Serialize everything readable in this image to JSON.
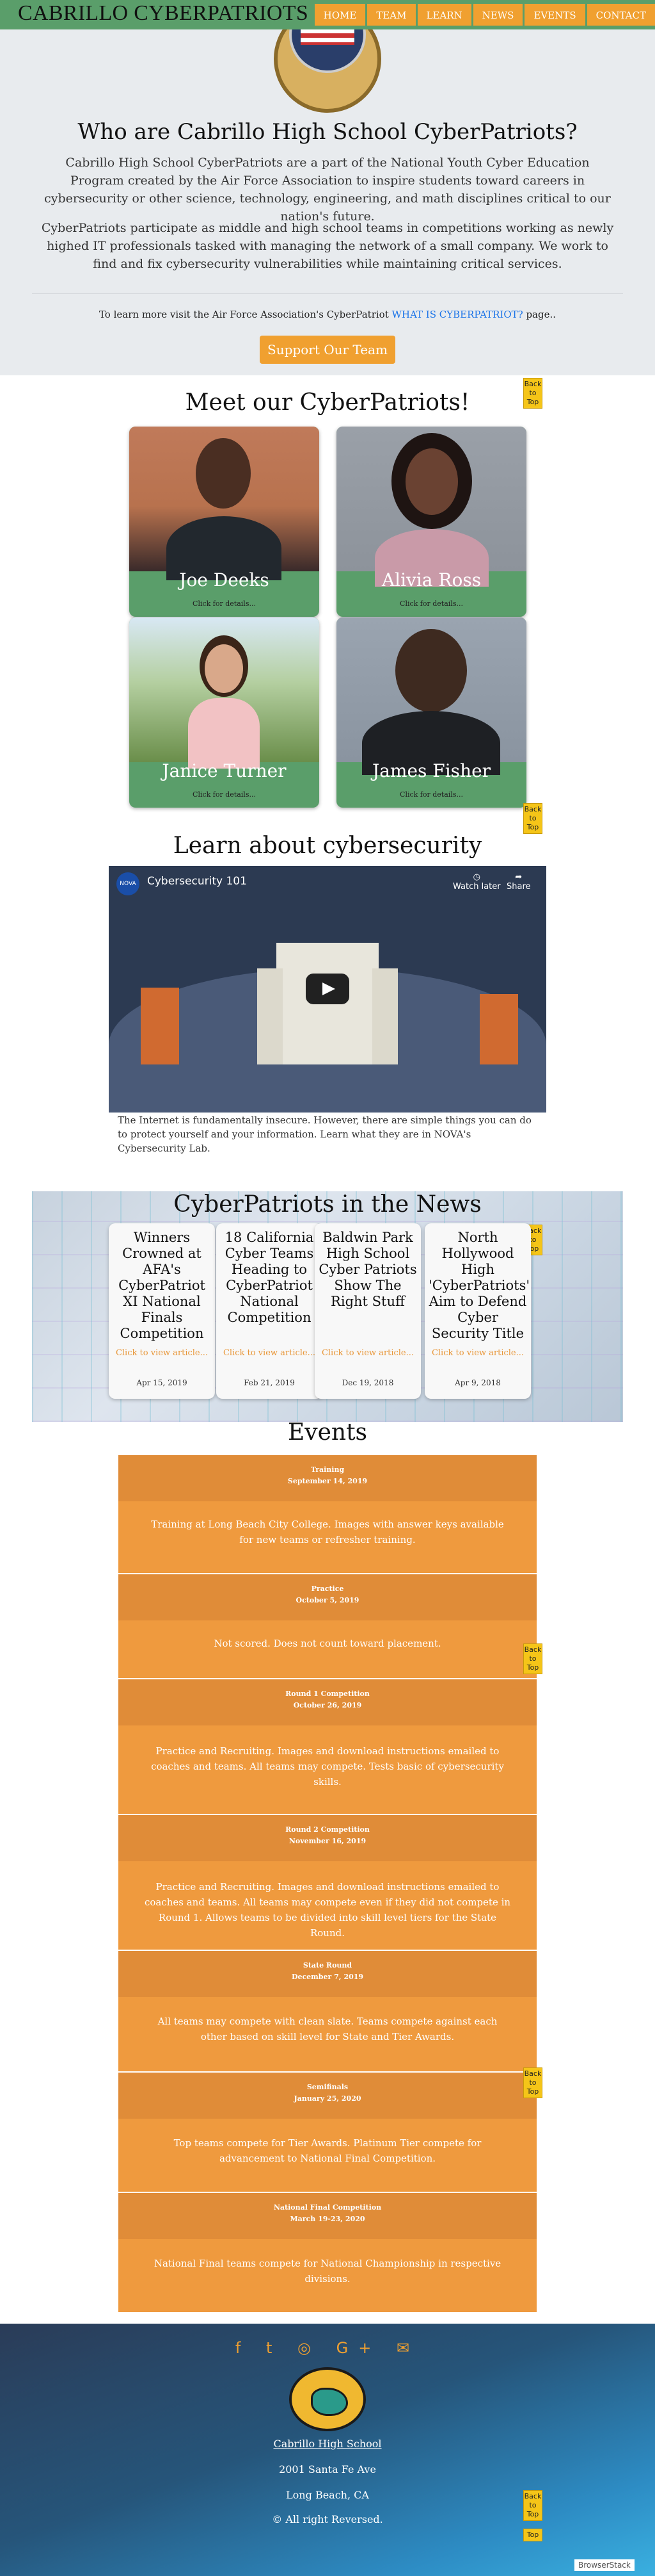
{
  "nav": {
    "brand": "CABRILLO CYBERPATRIOTS",
    "items": [
      "HOME",
      "TEAM",
      "LEARN",
      "NEWS",
      "EVENTS",
      "CONTACT"
    ]
  },
  "hero": {
    "title": "Who are Cabrillo High School CyberPatriots?",
    "p1": "Cabrillo High School CyberPatriots are a part of the National Youth Cyber Education Program created by the Air Force Association to inspire students toward careers in cybersecurity or other science, technology, engineering, and math disciplines critical to our nation's future.",
    "p2": "CyberPatriots participate as middle and high school teams in competitions working as newly highed IT professionals tasked with managing the network of a small company. We work to find and fix cybersecurity vulnerabilities while maintaining critical services.",
    "learn_prefix": "To learn more visit the Air Force Association's CyberPatriot ",
    "learn_link": "WHAT IS CYBERPATRIOT?",
    "learn_suffix": " page..",
    "support_button": "Support Our Team"
  },
  "back_to_top": "Back to Top",
  "back_to_top_short": "Top",
  "meet": {
    "title": "Meet our CyberPatriots!",
    "details_label": "Click for details...",
    "members": [
      "Joe Deeks",
      "Alivia Ross",
      "Janice Turner",
      "James Fisher"
    ]
  },
  "learn": {
    "title": "Learn about cybersecurity",
    "video_title": "Cybersecurity 101",
    "video_channel": "NOVA",
    "watch_later": "Watch later",
    "share": "Share",
    "description": "The Internet is fundamentally insecure. However, there are simple things you can do to protect yourself and your information. Learn what they are in NOVA's Cybersecurity Lab."
  },
  "news": {
    "title": "CyberPatriots in the News",
    "click_label": "Click to view article...",
    "articles": [
      {
        "title": "Winners Crowned at AFA's CyberPatriot XI National Finals Competition",
        "date": "Apr 15, 2019"
      },
      {
        "title": "18 California Cyber Teams Heading to CyberPatriot National Competition",
        "date": "Feb 21, 2019"
      },
      {
        "title": "Baldwin Park High School Cyber Patriots Show The Right Stuff",
        "date": "Dec 19, 2018"
      },
      {
        "title": "North Hollywood High 'CyberPatriots' Aim to Defend Cyber Security Title",
        "date": "Apr 9, 2018"
      }
    ]
  },
  "events": {
    "title": "Events",
    "items": [
      {
        "name": "Training",
        "date": "September 14, 2019",
        "desc": "Training at Long Beach City College. Images with answer keys available for new teams or refresher training."
      },
      {
        "name": "Practice",
        "date": "October 5, 2019",
        "desc": "Not scored. Does not count toward placement."
      },
      {
        "name": "Round 1 Competition",
        "date": "October 26, 2019",
        "desc": "Practice and Recruiting. Images and download instructions emailed to coaches and teams. All teams may compete. Tests basic of cybersecurity skills."
      },
      {
        "name": "Round 2 Competition",
        "date": "November 16, 2019",
        "desc": "Practice and Recruiting. Images and download instructions emailed to coaches and teams. All teams may compete even if they did not compete in Round 1. Allows teams to be divided into skill level tiers for the State Round."
      },
      {
        "name": "State Round",
        "date": "December 7, 2019",
        "desc": "All teams may compete with clean slate. Teams compete against each other based on skill level for State and Tier Awards."
      },
      {
        "name": "Semifinals",
        "date": "January 25, 2020",
        "desc": "Top teams compete for Tier Awards. Platinum Tier compete for advancement to National Final Competition."
      },
      {
        "name": "National Final Competition",
        "date": "March 19-23, 2020",
        "desc": "National Final teams compete for National Championship in respective divisions."
      }
    ]
  },
  "footer": {
    "icons": [
      "facebook-icon",
      "twitter-icon",
      "instagram-icon",
      "google-plus-icon",
      "mail-icon"
    ],
    "icon_glyphs": "f  t  ◎  G+  ✉",
    "school": "Cabrillo High School",
    "address": "2001 Santa Fe Ave",
    "city": "Long Beach, CA",
    "copyright": "© All right Reversed."
  },
  "watermark": "BrowserStack",
  "colors": {
    "nav": "#5a9e6a",
    "accent": "#f0a030",
    "card_green": "#5a9e6a",
    "event_header": "#e08c38",
    "event_body": "#ef9a3e",
    "link": "#1a73e8"
  }
}
